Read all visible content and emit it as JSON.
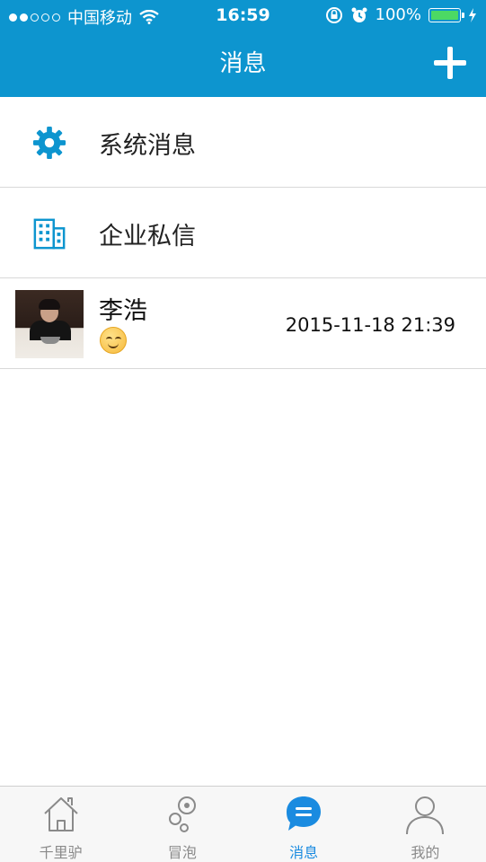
{
  "status_bar": {
    "carrier": "中国移动",
    "time": "16:59",
    "battery": "100%"
  },
  "nav": {
    "title": "消息",
    "add_icon": "plus-icon"
  },
  "list": {
    "items": [
      {
        "label": "系统消息",
        "icon": "gear-icon"
      },
      {
        "label": "企业私信",
        "icon": "building-icon"
      }
    ],
    "chat": {
      "name": "李浩",
      "preview_emoji": "smiling-face",
      "timestamp": "2015-11-18 21:39"
    }
  },
  "tabs": [
    {
      "label": "千里驴",
      "icon": "home-icon",
      "active": false
    },
    {
      "label": "冒泡",
      "icon": "bubbles-icon",
      "active": false
    },
    {
      "label": "消息",
      "icon": "message-icon",
      "active": true
    },
    {
      "label": "我的",
      "icon": "profile-icon",
      "active": false
    }
  ],
  "colors": {
    "brand": "#0d95cf",
    "active_tab": "#1a8be0",
    "battery": "#4cd964"
  }
}
